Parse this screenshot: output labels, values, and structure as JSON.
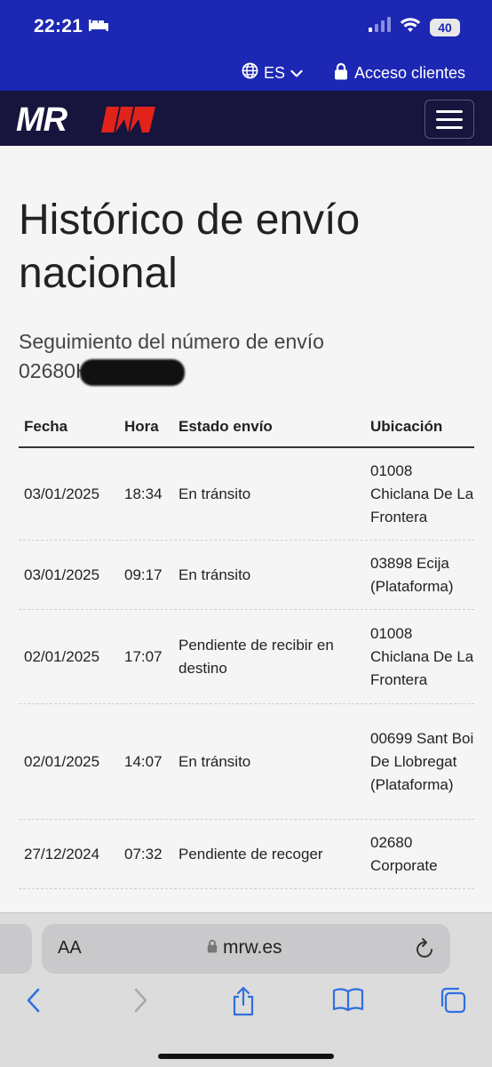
{
  "status_bar": {
    "time": "22:21",
    "battery": "40"
  },
  "top_bar": {
    "language": "ES",
    "access_label": "Acceso clientes"
  },
  "brand": {
    "logo_text": "MRW"
  },
  "page": {
    "title": "Histórico de envío nacional",
    "subtitle_label": "Seguimiento del número de envío",
    "tracking_prefix": "02680H"
  },
  "table": {
    "headers": {
      "fecha": "Fecha",
      "hora": "Hora",
      "estado": "Estado envío",
      "ubicacion": "Ubicación"
    },
    "rows": [
      {
        "fecha": "03/01/2025",
        "hora": "18:34",
        "estado": "En tránsito",
        "ubicacion": "01008 Chiclana De La Frontera"
      },
      {
        "fecha": "03/01/2025",
        "hora": "09:17",
        "estado": "En tránsito",
        "ubicacion": "03898 Ecija (Plataforma)"
      },
      {
        "fecha": "02/01/2025",
        "hora": "17:07",
        "estado": "Pendiente de recibir en destino",
        "ubicacion": "01008 Chiclana De La Frontera"
      },
      {
        "fecha": "02/01/2025",
        "hora": "14:07",
        "estado": "En tránsito",
        "ubicacion": "00699 Sant Boi De Llobregat (Plataforma)"
      },
      {
        "fecha": "27/12/2024",
        "hora": "07:32",
        "estado": "Pendiente de recoger",
        "ubicacion": "02680 Corporate"
      }
    ]
  },
  "browser": {
    "text_size_label": "AA",
    "url": "mrw.es"
  },
  "icons": {
    "bed": "bed-icon",
    "signal": "signal-icon",
    "wifi": "wifi-icon",
    "globe": "globe-icon",
    "chevron": "chevron-down-icon",
    "lock": "lock-icon",
    "menu": "hamburger-menu-icon",
    "reload": "reload-icon",
    "back": "back-arrow-icon",
    "forward": "forward-arrow-icon",
    "share": "share-icon",
    "bookmarks": "bookmarks-icon",
    "tabs": "tabs-icon"
  },
  "colors": {
    "brand_blue": "#1c27b4",
    "nav_dark": "#17143d",
    "accent_red": "#e2231a",
    "ios_blue": "#2f6fe0"
  }
}
